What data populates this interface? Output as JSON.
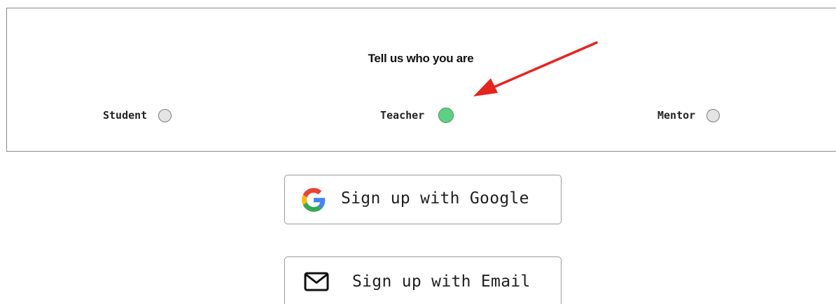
{
  "role_selector": {
    "title": "Tell us who you are",
    "options": [
      {
        "label": "Student",
        "selected": false
      },
      {
        "label": "Teacher",
        "selected": true
      },
      {
        "label": "Mentor",
        "selected": false
      }
    ]
  },
  "signup": {
    "google_label": "Sign up with Google",
    "email_label": "Sign up with Email"
  },
  "colors": {
    "selected_radio": "#5ed083",
    "unselected_radio": "#e4e4e4",
    "annotation_arrow": "#e8221c"
  },
  "icons": {
    "google": "google-logo-icon",
    "email": "envelope-icon",
    "annotation": "red-arrow-icon"
  }
}
